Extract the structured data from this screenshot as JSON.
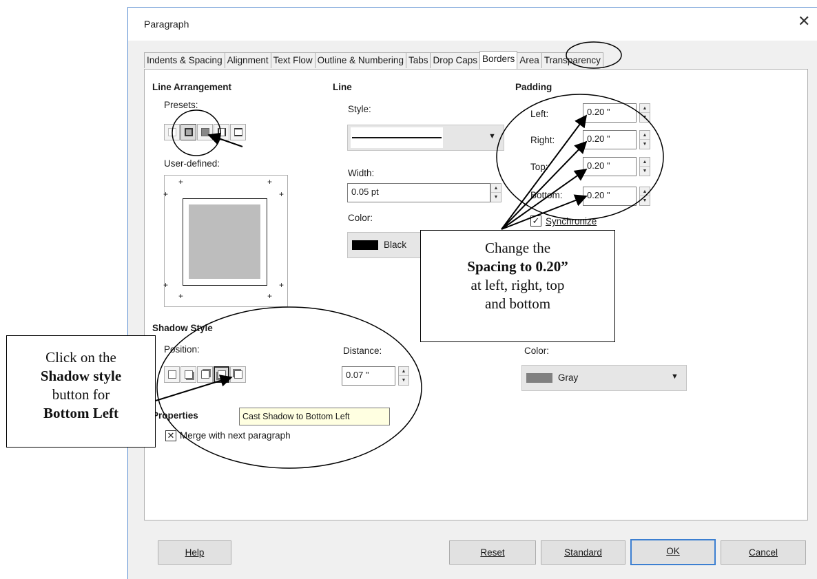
{
  "dialog": {
    "title": "Paragraph",
    "close_glyph": "✕"
  },
  "tabs": [
    {
      "label": "Indents & Spacing"
    },
    {
      "label": "Alignment"
    },
    {
      "label": "Text Flow"
    },
    {
      "label": "Outline & Numbering"
    },
    {
      "label": "Tabs"
    },
    {
      "label": "Drop Caps"
    },
    {
      "label": "Borders",
      "active": true
    },
    {
      "label": "Area"
    },
    {
      "label": "Transparency"
    }
  ],
  "line_arrangement": {
    "header": "Line Arrangement",
    "presets_label": "Presets:",
    "user_defined_label": "User-defined:"
  },
  "line": {
    "header": "Line",
    "style_label": "Style:",
    "width_label": "Width:",
    "width_value": "0.05 pt",
    "color_label": "Color:",
    "color_value": "Black",
    "color_swatch": "#000000"
  },
  "padding": {
    "header": "Padding",
    "left_label": "Left:",
    "left_value": "0.20 \"",
    "right_label": "Right:",
    "right_value": "0.20 \"",
    "top_label": "Top:",
    "top_value": "0.20 \"",
    "bottom_label": "Bottom:",
    "bottom_value": "0.20 \"",
    "synchronize_label": "Synchronize",
    "synchronize_checked": true
  },
  "shadow": {
    "header": "Shadow Style",
    "position_label": "Position:",
    "distance_label": "Distance:",
    "distance_value": "0.07 \"",
    "color_label": "Color:",
    "color_value": "Gray",
    "color_swatch": "#808080",
    "tooltip": "Cast Shadow to Bottom Left"
  },
  "properties": {
    "header": "Properties",
    "merge_label": "Merge with next paragraph",
    "merge_checked": true
  },
  "buttons": {
    "help": "Help",
    "reset": "Reset",
    "standard": "Standard",
    "ok": "OK",
    "cancel": "Cancel"
  },
  "annotations": {
    "padding_callout": [
      "Change the",
      "Spacing to 0.20”",
      "at left, right, top",
      "and bottom"
    ],
    "shadow_callout": [
      "Click on the",
      "Shadow style",
      "button for",
      "Bottom Left"
    ]
  }
}
